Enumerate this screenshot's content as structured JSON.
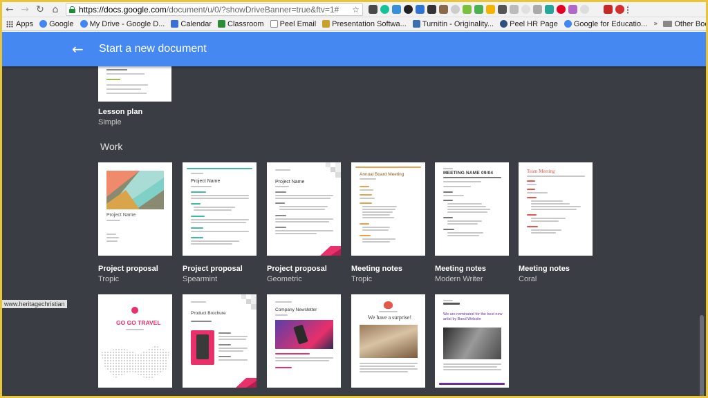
{
  "browser": {
    "url_host": "https://docs.google.com",
    "url_path": "/document/u/0/?showDriveBanner=true&ftv=1#",
    "bookmarks": [
      {
        "label": "Apps",
        "color": "#555555"
      },
      {
        "label": "Google",
        "color": "#4285f4"
      },
      {
        "label": "My Drive - Google D...",
        "color": "#4285f4"
      },
      {
        "label": "Calendar",
        "color": "#3b6fd6"
      },
      {
        "label": "Classroom",
        "color": "#2e8b3a"
      },
      {
        "label": "Peel Email",
        "color": "#888888"
      },
      {
        "label": "Presentation Softwa...",
        "color": "#c9a02a"
      },
      {
        "label": "Turnitin - Originality...",
        "color": "#3a6fb0"
      },
      {
        "label": "Peel HR Page",
        "color": "#2f4f7f"
      },
      {
        "label": "Google for Educatio...",
        "color": "#4285f4"
      }
    ],
    "other_bookmarks": "Other Bookmarks"
  },
  "header": {
    "title": "Start a new document",
    "color": "#4688f1"
  },
  "lesson": {
    "name": "Lesson plan",
    "style": "Simple"
  },
  "section": {
    "title": "Work"
  },
  "row1": [
    {
      "name": "Project proposal",
      "style": "Tropic",
      "heading": "Project Name"
    },
    {
      "name": "Project proposal",
      "style": "Spearmint",
      "heading": "Project Name"
    },
    {
      "name": "Project proposal",
      "style": "Geometric",
      "heading": "Project Name"
    },
    {
      "name": "Meeting notes",
      "style": "Tropic",
      "heading": "Annual Board Meeting"
    },
    {
      "name": "Meeting notes",
      "style": "Modern Writer",
      "heading": "MEETING NAME 09/04"
    },
    {
      "name": "Meeting notes",
      "style": "Coral",
      "heading": "Team Meeting"
    }
  ],
  "row2": [
    {
      "heading": "GO GO TRAVEL"
    },
    {
      "heading": "Product Brochure"
    },
    {
      "heading": "Company Newsletter"
    },
    {
      "heading": "We have a surprise!"
    },
    {
      "heading": "We are nominated for the best new artist by Band Website"
    }
  ],
  "watermark": "www.heritagechristian"
}
